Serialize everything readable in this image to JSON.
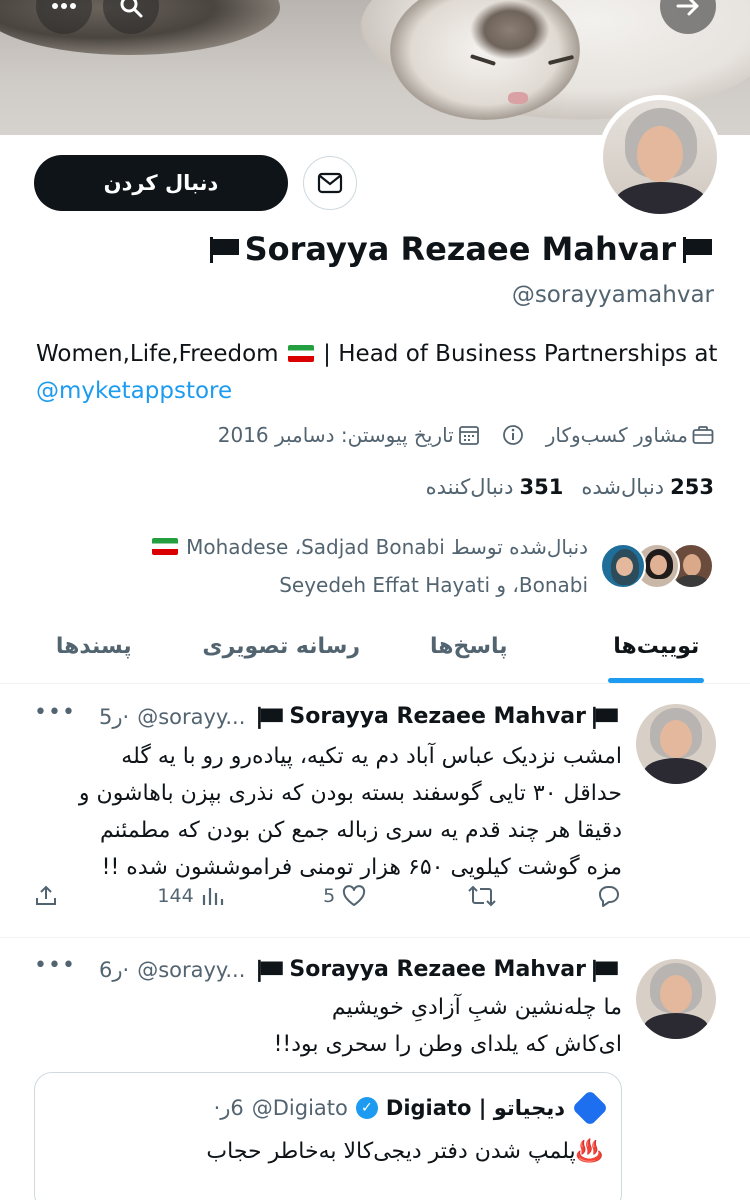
{
  "profile": {
    "follow_label": "دنبال کردن",
    "name": "Sorayya Rezaee Mahvar",
    "handle": "@sorayyamahvar",
    "bio_pre": "Women,Life,Freedom",
    "bio_mid": " | Head of Business Partnerships at ",
    "bio_link": "@myketappstore",
    "category": "مشاور کسب‌وکار",
    "joined": "تاریخ پیوستن: دسامبر 2016",
    "following_count": "253",
    "following_label": "دنبال‌شده",
    "followers_count": "351",
    "followers_label": "دنبال‌کننده",
    "followed_by_line1": "دنبال‌شده توسط Mohadese ،Sadjad Bonabi",
    "followed_by_line2": "Bonabi، و Seyedeh Effat Hayati"
  },
  "tabs": [
    {
      "label": "توییت‌ها",
      "active": true
    },
    {
      "label": "پاسخ‌ها",
      "active": false
    },
    {
      "label": "رسانه تصویری",
      "active": false
    },
    {
      "label": "پسندها",
      "active": false
    }
  ],
  "tweets": [
    {
      "name": "Sorayya Rezaee Mahvar",
      "handle": "@sorayy...",
      "time": "5ر·",
      "lines": [
        "امشب نزدیک عباس آباد دم یه تکیه، پیاده‌رو رو با یه گله",
        "حداقل ۳۰ تایی گوسفند بسته بودن که نذری بپزن باهاشون و",
        "دقیقا هر چند قدم یه سری زباله جمع کن بودن که مطمئنم",
        "مزه گوشت کیلویی ۶۵۰ هزار تومنی فراموششون شده !!"
      ],
      "views": "144",
      "likes": "5"
    },
    {
      "name": "Sorayya Rezaee Mahvar",
      "handle": "@sorayy...",
      "time": "6ر·",
      "lines": [
        "ما چله‌نشین شبِ آزادیِ خویشیم",
        "ای‌کاش که یلدای وطن را سحری بود!!"
      ]
    }
  ],
  "quote": {
    "name": "Digiato | دیجیاتو",
    "handle": "@Digiato",
    "time": "6ر·",
    "text": "♨️پلمپ شدن دفتر دیجی‌کالا به‌خاطر حجاب"
  },
  "colors": {
    "accent": "#1d9bf0",
    "text": "#0f1419",
    "muted": "#536471"
  }
}
